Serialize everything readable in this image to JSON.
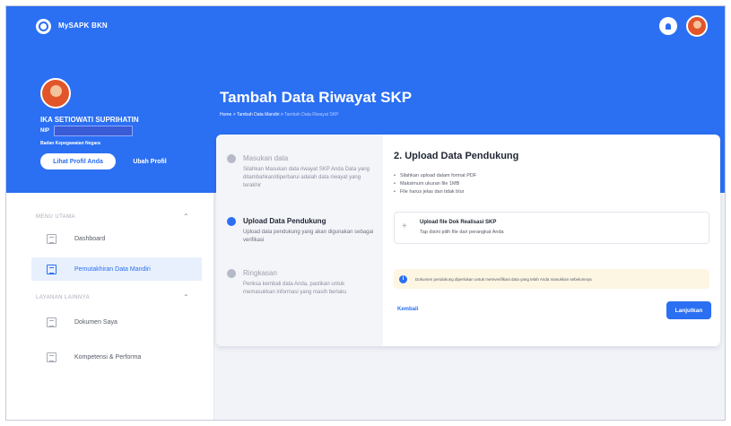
{
  "app": {
    "name": "MySAPK BKN"
  },
  "profile": {
    "name": "IKA SETIOWATI SUPRIHATIN",
    "nip_label": "NIP",
    "organization": "Badan Kepegawaian Negara",
    "view_button": "Lihat Profil Anda",
    "edit_button": "Ubah Profil"
  },
  "sidebar": {
    "section_main": "MENU UTAMA",
    "items_main": [
      {
        "label": "Dashboard"
      },
      {
        "label": "Pemutakhiran Data Mandiri"
      }
    ],
    "section_other": "LAYANAN LAINNYA",
    "items_other": [
      {
        "label": "Dokumen Saya"
      },
      {
        "label": "Kompetensi & Performa"
      }
    ]
  },
  "page": {
    "title": "Tambah Data Riwayat SKP",
    "breadcrumb": {
      "home": "Home",
      "sep": ">",
      "parent": "Tambah Data Mandiri",
      "current": "Tambah Data Riwayat SKP"
    }
  },
  "steps": [
    {
      "title": "Masukan data",
      "desc": "Silahkan Masukan data riwayat SKP Anda Data yang ditambahkan/diperbarui adalah data riwayat yang terakhir"
    },
    {
      "title": "Upload Data Pendukung",
      "desc": "Upload data pendukung yang akan digunakan sebagai verifikasi"
    },
    {
      "title": "Ringkasan",
      "desc": "Periksa kembali data Anda, pastikan untuk memasukkan informasi yang masih berlaku"
    }
  ],
  "content": {
    "title": "2. Upload Data Pendukung",
    "rules": [
      "Silahkan upload dalam format PDF",
      "Maksimum ukuran file 1MB",
      "File harus jelas dan tidak blur"
    ],
    "upload_title": "Upload file Dok Realisasi SKP",
    "upload_sub": "Tap disini pilih file dari perangkat Anda",
    "notice": "Dokumen pendukung diperlukan untuk memverifikasi data yang telah Anda masukkan sebelumnya",
    "back_button": "Kembali",
    "next_button": "Lanjutkan"
  },
  "colors": {
    "primary": "#2b6ff3",
    "notice_bg": "#fdf6e3"
  },
  "icons": [
    "logo-icon",
    "bell-icon",
    "avatar",
    "chevron-up-icon",
    "dashboard-icon",
    "data-update-icon",
    "document-icon",
    "competence-icon",
    "plus-icon",
    "info-icon"
  ]
}
